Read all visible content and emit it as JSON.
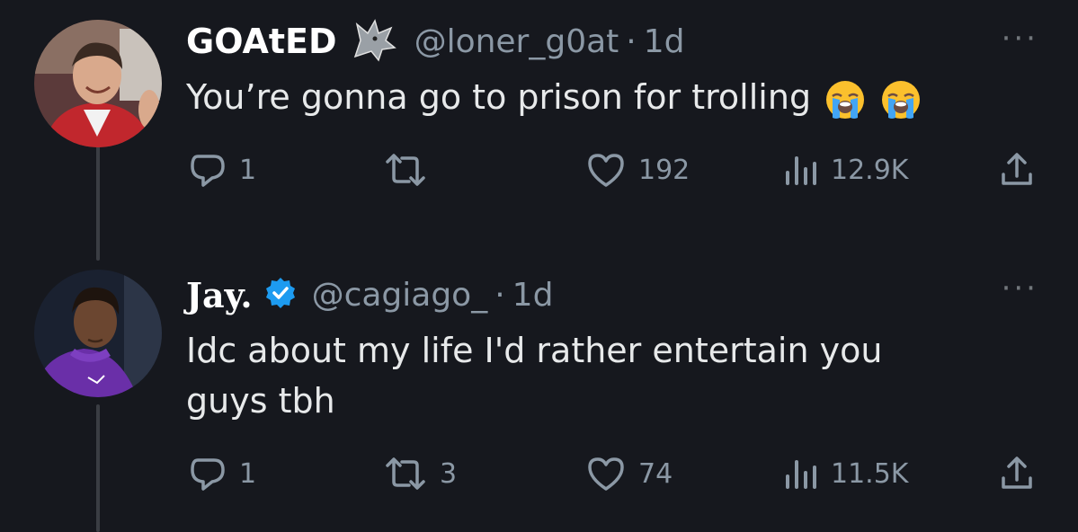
{
  "tweets": [
    {
      "display_name": "GOAtED",
      "badge_icon": "wolf-icon",
      "handle": "@loner_g0at",
      "separator": "·",
      "time": "1d",
      "more_label": "···",
      "text": "You’re gonna go to prison for trolling",
      "emojis": [
        "loudly-crying-face-emoji",
        "loudly-crying-face-emoji"
      ],
      "replies": "1",
      "retweets": "",
      "likes": "192",
      "views": "12.9K"
    },
    {
      "display_name": "Jay.",
      "badge_icon": "verified-icon",
      "handle": "@cagiago_",
      "separator": "·",
      "time": "1d",
      "more_label": "···",
      "text_line1": "Idc about my life I'd rather entertain you",
      "text_line2": "guys tbh",
      "replies": "1",
      "retweets": "3",
      "likes": "74",
      "views": "11.5K"
    }
  ],
  "colors": {
    "background": "#16181e",
    "text": "#e7e9ea",
    "muted": "#8b98a5",
    "verified": "#1d9bf0"
  }
}
